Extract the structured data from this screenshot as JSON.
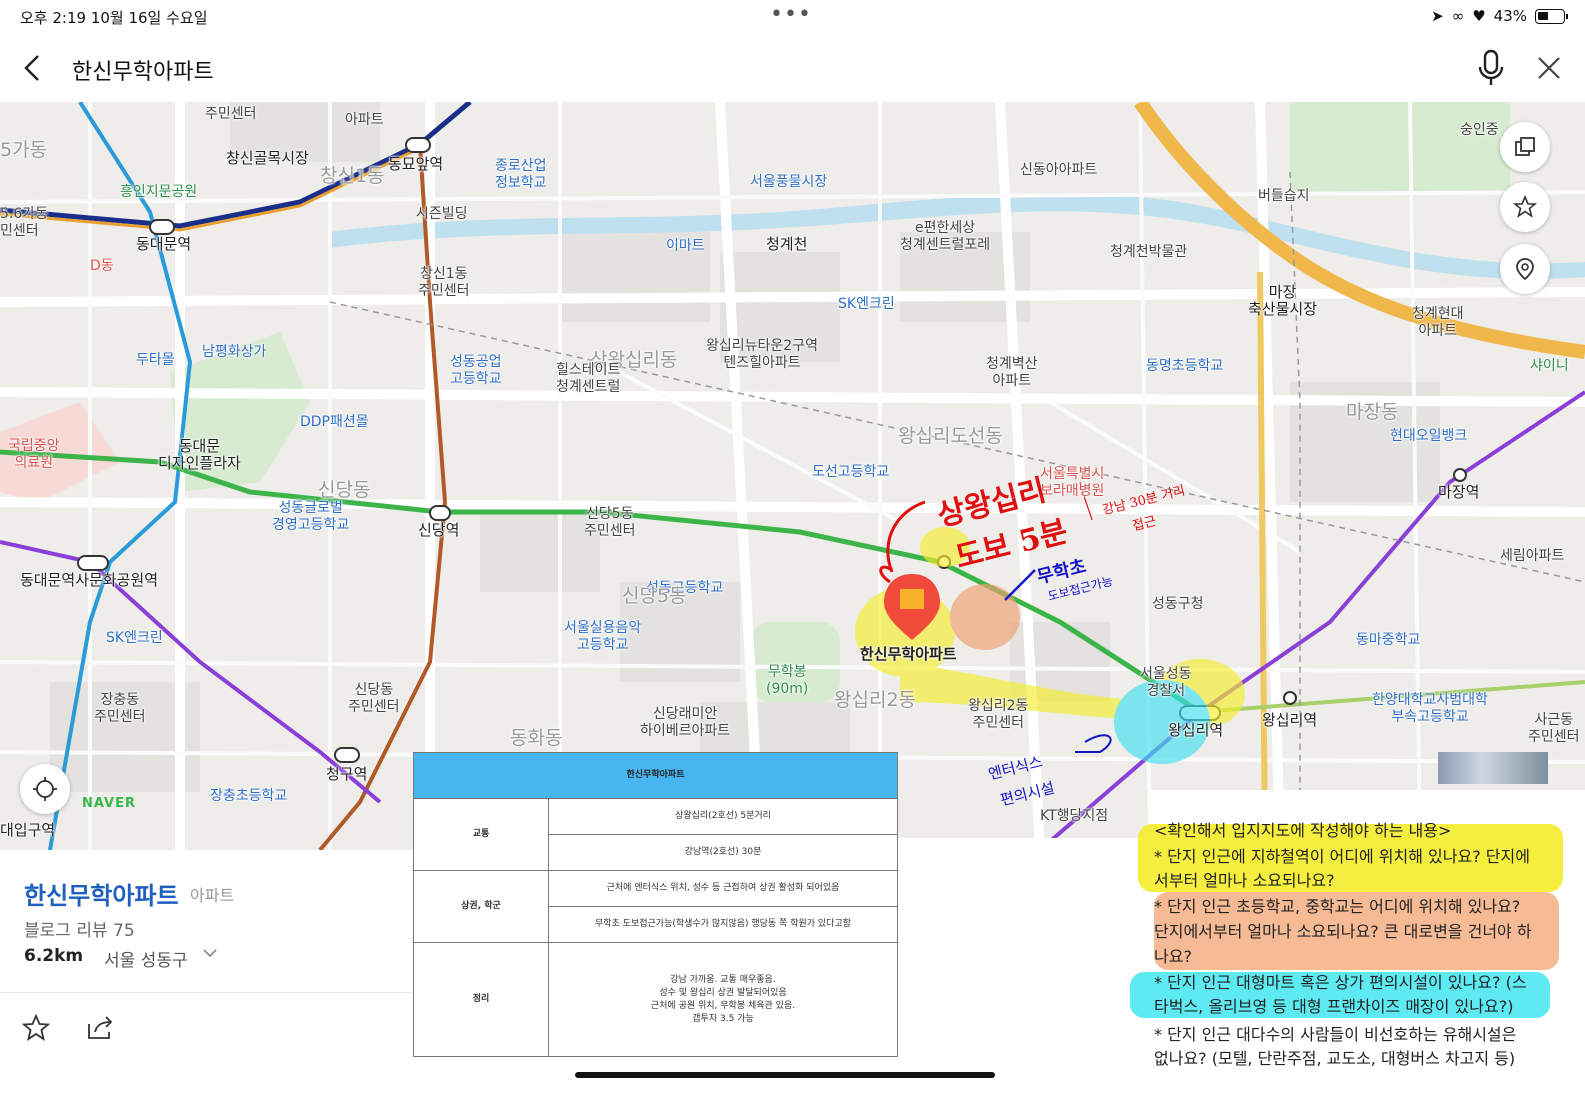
{
  "status_bar": {
    "time": "오후 2:19   10월 16일 수요일",
    "battery": "43%",
    "battery_level": 0.43
  },
  "search": {
    "query": "한신무학아파트"
  },
  "map": {
    "labels": {
      "juminsenter_top": "주민센터",
      "apt_top": "아파트",
      "changsin_alley": "창신골목시장",
      "changsin1": "창신1동",
      "dongmyo": "동묘앞역",
      "jongno": "종로산업\n정보학교",
      "seoul_pung": "서울풍물시장",
      "sindong_apt": "신동아아파트",
      "sunginjung": "숭인중",
      "heunginji": "흥인지문공원",
      "gadong": "5가동",
      "gadong2": "5.6가동\n민센터",
      "dongdaemun": "동대문역",
      "sijeon": "시즌빌딩",
      "emart": "이마트",
      "cheonggyecheon": "청계천",
      "epyeonhan": "e편한세상\n청계센트럴포레",
      "beodeul": "버들습지",
      "cheonggye_museum": "청계천박물관",
      "ddong": "D동",
      "changsin_center": "창신1동\n주민센터",
      "sk_top": "SK엔크린",
      "majang_market": "마장\n축산물시장",
      "cheonggye_hyundai": "청계현대\n아파트",
      "doota": "두타몰",
      "pyeonghwa": "남평화상가",
      "seongdong_tech": "성동공업\n고등학교",
      "sanghadong": "상왕십리동",
      "hillstate": "힐스테이트\n청계센트럴",
      "tenzhill": "왕십리뉴타운2구역\n텐즈힐아파트",
      "byeoksan": "청계벽산\n아파트",
      "dongmyeong": "동명초등학교",
      "shine": "샤이니",
      "majangdong": "마장동",
      "hyundai_bank": "현대오일뱅크",
      "national": "국립중앙\n의료원",
      "ddp": "DDP패션몰",
      "ddp_plaza": "동대문\n디자인플라자",
      "wangsimni_doseon": "왕십리도선동",
      "seoul_hospital": "서울특별시\n보라매병원",
      "doseon_high": "도선고등학교",
      "majang_station": "마장역",
      "seongdong_global": "성동글로벌\n경영고등학교",
      "sindang_dong": "신당동",
      "sindang_station": "신당역",
      "sindang5": "신당5동\n주민센터",
      "serim": "세림아파트",
      "ddm_history": "동대문역사문화공원역",
      "seongdong_high": "성동고등학교",
      "sindang5_area": "신당5동",
      "seongdong_office": "성동구청",
      "sk_left": "SK엔크린",
      "seoul_music": "서울실용음악\n고등학교",
      "dongma": "동마중학교",
      "muhakbong": "무학봉\n(90m)",
      "target": "한신무학아파트",
      "police": "서울성동\n경찰서",
      "hanyang": "한양대학교사범대학\n부속고등학교",
      "jangchung_center": "장충동\n주민센터",
      "sindang_center": "신당동\n주민센터",
      "sindang_raemian": "신당래미안\n하이베르아파트",
      "wangsimni2dong": "왕십리2동",
      "wangsimni2_center": "왕십리2동\n주민센터",
      "wangsimni_station": "왕십리역",
      "wangsimni_station2": "왕십리역",
      "sagun": "사근동\n주민센터",
      "cheonggu": "청구역",
      "hwadong": "동화동",
      "jangchung_elem": "장충초등학교",
      "ddm_ipgu": "대입구역",
      "kt": "KT행당지점"
    },
    "logo": "NAVER",
    "handwriting": {
      "red_big_line1": "상왕십리",
      "red_big_line2": "도보 5분",
      "red_small_line1": "강남 30분 거리",
      "red_small_line2": "접근",
      "blue_big": "무학초",
      "blue_small": "도보접근가능",
      "blue_left_line1": "엔터식스",
      "blue_left_line2": "편의시설"
    }
  },
  "place_card": {
    "name": "한신무학아파트",
    "category": "아파트",
    "review": "블로그 리뷰 75",
    "distance": "6.2km",
    "address": "서울 성동구",
    "chevron_icon": "chevron-down-icon",
    "actions": [
      "star-icon",
      "share-icon"
    ]
  },
  "table": {
    "title": "한신무학아파트",
    "rows": [
      {
        "category": "교통",
        "items": [
          "상왕십리(2호선) 5분거리",
          "강남역(2호선) 30분"
        ]
      },
      {
        "category": "상권, 학군",
        "items": [
          "근처에 엔터식스 위치, 성수 등 근접하여 상권 활성화 되어있음",
          "무학초 도보접근가능(학생수가 많지않음) 행당동 쪽 학원가 있다고함"
        ]
      },
      {
        "category": "정리",
        "items": [
          "강남 가까움. 교통 매우좋음.\n성수 및 왕십리 상권 발달되어있음\n근처에 공원 위치, 무학봉 체육관 있음.\n갭투자 3.5 가능"
        ]
      }
    ]
  },
  "notes": {
    "heading": "<확인해서 입지지도에 작성해야 하는 내용>",
    "lines": [
      "* 단지 인근에 지하철역이 어디에 위치해 있나요? 단지에",
      "서부터 얼마나 소요되나요?",
      "* 단지 인근 초등학교, 중학교는 어디에 위치해 있나요?",
      "단지에서부터 얼마나 소요되나요? 큰 대로변을 건너야 하",
      "나요?",
      "* 단지 인근 대형마트 혹은 상가 편의시설이 있나요? (스",
      "타벅스, 올리브영 등 대형 프랜차이즈 매장이 있나요?)",
      "* 단지 인근 대다수의 사람들이 비선호하는 유해시설은",
      "없나요? (모텔, 단란주점, 교도소, 대형버스 차고지 등)"
    ]
  },
  "colors": {
    "line2_green": "#3cb44a",
    "purple_line": "#8b3fd6",
    "brand_blue": "#1f5fbf",
    "table_header": "#48b6f0"
  }
}
